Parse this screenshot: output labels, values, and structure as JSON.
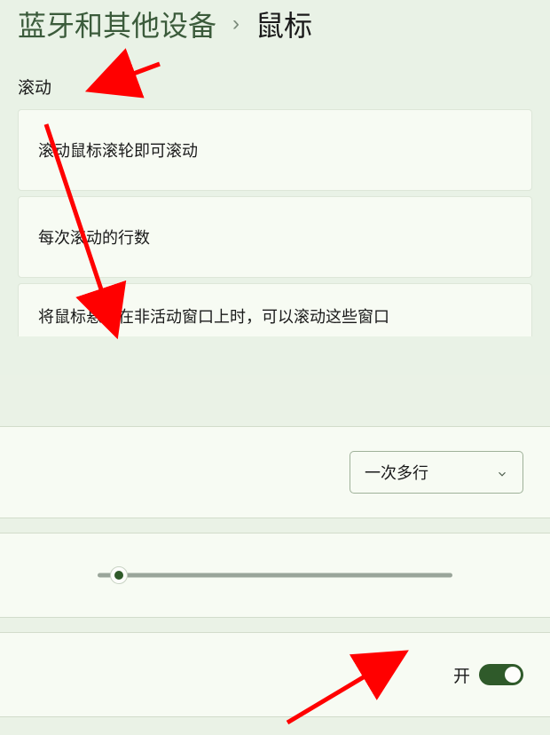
{
  "breadcrumb": {
    "parent": "蓝牙和其他设备",
    "separator": "›",
    "current": "鼠标"
  },
  "section": {
    "title": "滚动"
  },
  "rows": {
    "scroll_wheel": "滚动鼠标滚轮即可滚动",
    "lines_per_scroll": "每次滚动的行数",
    "hover_inactive": "将鼠标悬停在非活动窗口上时，可以滚动这些窗口"
  },
  "controls": {
    "dropdown_value": "一次多行",
    "toggle_label": "开"
  },
  "annotations": {
    "color": "#ff0000"
  }
}
